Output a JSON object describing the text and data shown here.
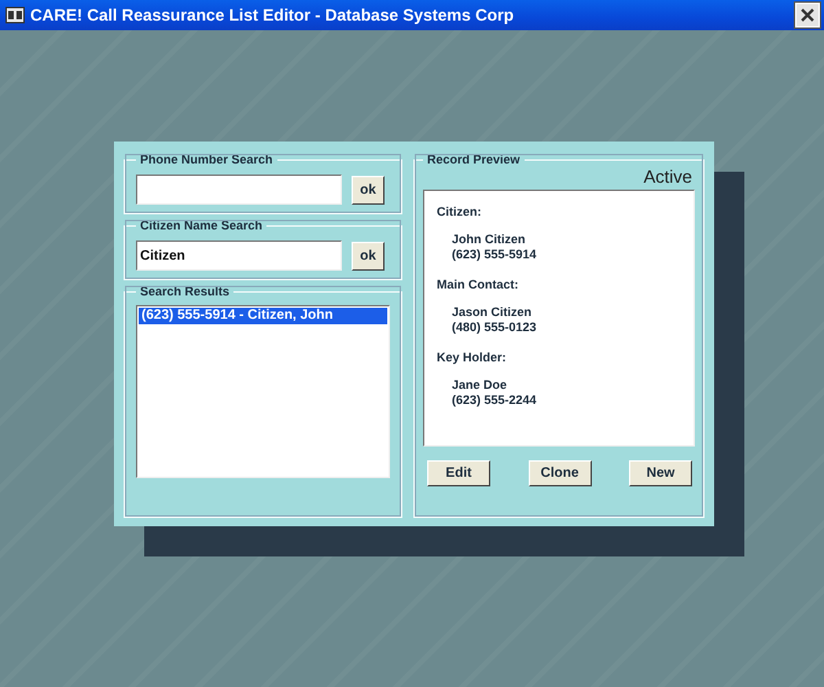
{
  "window": {
    "title": "CARE! Call Reassurance List Editor - Database Systems Corp"
  },
  "phone_search": {
    "label": "Phone Number Search",
    "button": "ok"
  },
  "name_search": {
    "label": "Citizen Name Search",
    "value": "Citizen",
    "button": "ok"
  },
  "search_results": {
    "label": "Search Results",
    "items": [
      {
        "text": "(623) 555-5914 - Citizen, John",
        "selected": true
      }
    ]
  },
  "record_preview": {
    "label": "Record Preview",
    "status": "Active",
    "sections": [
      {
        "heading": "Citizen:",
        "name": "John Citizen",
        "phone": "(623) 555-5914"
      },
      {
        "heading": "Main Contact:",
        "name": "Jason Citizen",
        "phone": "(480) 555-0123"
      },
      {
        "heading": "Key Holder:",
        "name": "Jane Doe",
        "phone": "(623) 555-2244"
      }
    ],
    "buttons": [
      "Edit",
      "Clone",
      "New"
    ]
  }
}
